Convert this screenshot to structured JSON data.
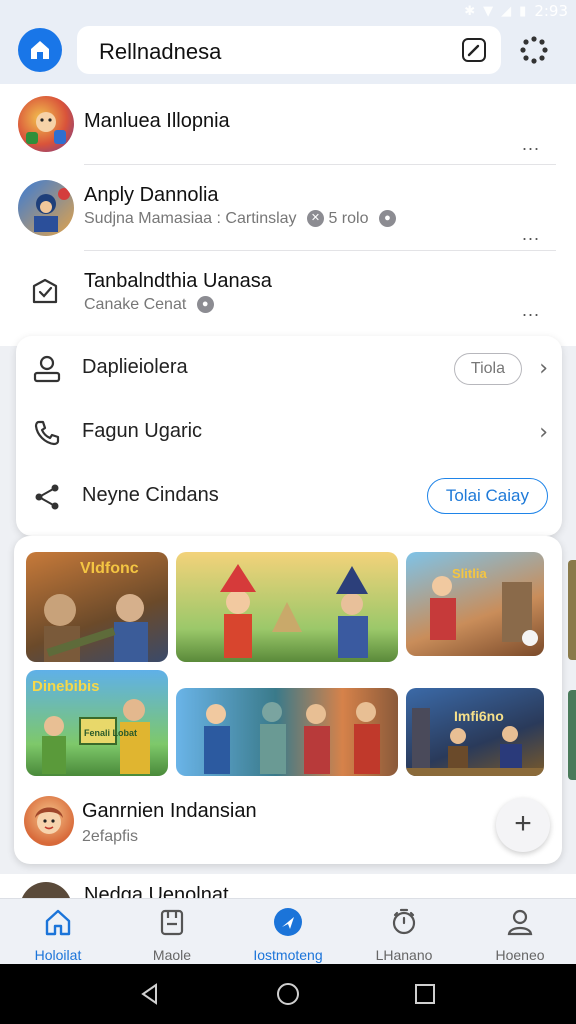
{
  "status": {
    "time": "2:93"
  },
  "search": {
    "text": "Rellnadnesa"
  },
  "list": {
    "items": [
      {
        "title": "Manluea Illopnia",
        "subtitle": "",
        "more": "..."
      },
      {
        "title": "Anply Dannolia",
        "subtitle": "Sudjna Mamasiaa : Cartinslay",
        "subtitle_extra": "5 rolo",
        "more": "..."
      },
      {
        "title": "Tanbalndthia Uanasa",
        "subtitle": "Canake Cenat",
        "more": "..."
      }
    ]
  },
  "settings": {
    "rows": [
      {
        "label": "Daplieiolera",
        "pill": "Tiola"
      },
      {
        "label": "Fagun Ugaric"
      },
      {
        "label": "Neyne Cindans",
        "pill": "Tolai Caiay"
      }
    ]
  },
  "games": {
    "thumb_texts": [
      "VIdfonc",
      "Slitlia",
      "Dinebibis",
      "Fenali Lobat",
      "Imfi6no"
    ],
    "title": "Ganrnien Indansian",
    "subtitle": "2efapfis",
    "fab": "+"
  },
  "next_item": {
    "title": "Nedga Uenolnat"
  },
  "nav": [
    {
      "label": "Holoilat"
    },
    {
      "label": "Maole"
    },
    {
      "label": "Iostmoteng"
    },
    {
      "label": "LHanano"
    },
    {
      "label": "Hoeneo"
    }
  ],
  "colors": {
    "accent": "#1976e8",
    "active_nav": "#1b74d9"
  }
}
